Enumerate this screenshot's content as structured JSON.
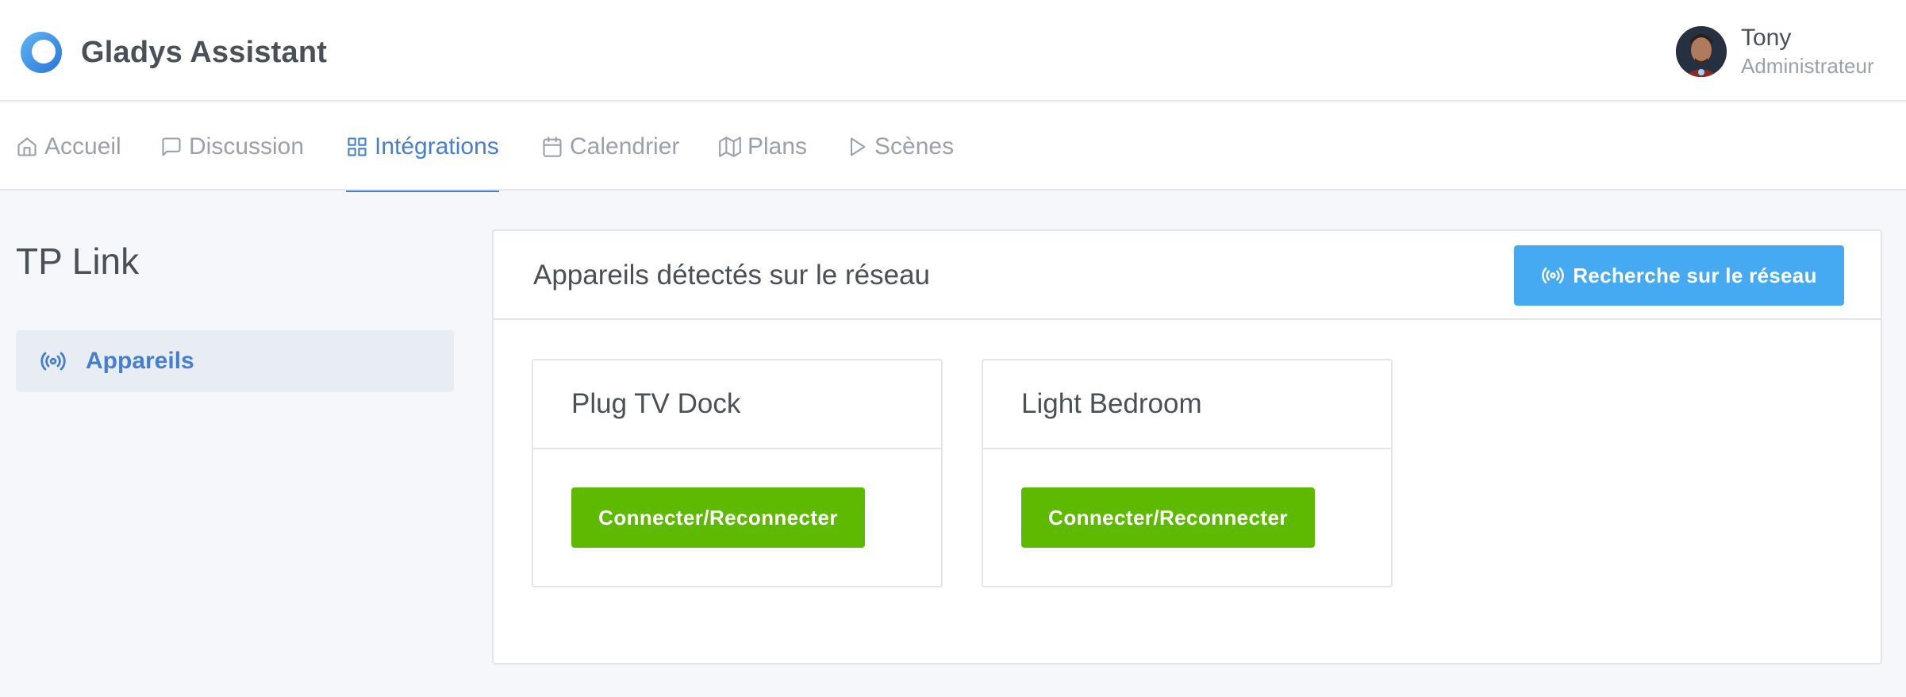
{
  "app": {
    "name": "Gladys Assistant"
  },
  "user": {
    "name": "Tony",
    "role": "Administrateur"
  },
  "nav": {
    "items": [
      {
        "label": "Accueil",
        "icon": "home-icon"
      },
      {
        "label": "Discussion",
        "icon": "message-square-icon"
      },
      {
        "label": "Intégrations",
        "icon": "grid-icon"
      },
      {
        "label": "Calendrier",
        "icon": "calendar-icon"
      },
      {
        "label": "Plans",
        "icon": "map-icon"
      },
      {
        "label": "Scènes",
        "icon": "play-icon"
      }
    ],
    "active": "Intégrations"
  },
  "sidebar": {
    "title": "TP Link",
    "items": [
      {
        "label": "Appareils",
        "icon": "radio-icon"
      }
    ]
  },
  "main": {
    "title": "Appareils détectés sur le réseau",
    "scan_label": "Recherche sur le réseau",
    "devices": [
      {
        "name": "Plug TV Dock",
        "button": "Connecter/Reconnecter"
      },
      {
        "name": "Light Bedroom",
        "button": "Connecter/Reconnecter"
      }
    ]
  },
  "colors": {
    "accent": "#467fcf",
    "info": "#45aaf2",
    "success": "#5eba00",
    "background": "#f5f7fb"
  }
}
